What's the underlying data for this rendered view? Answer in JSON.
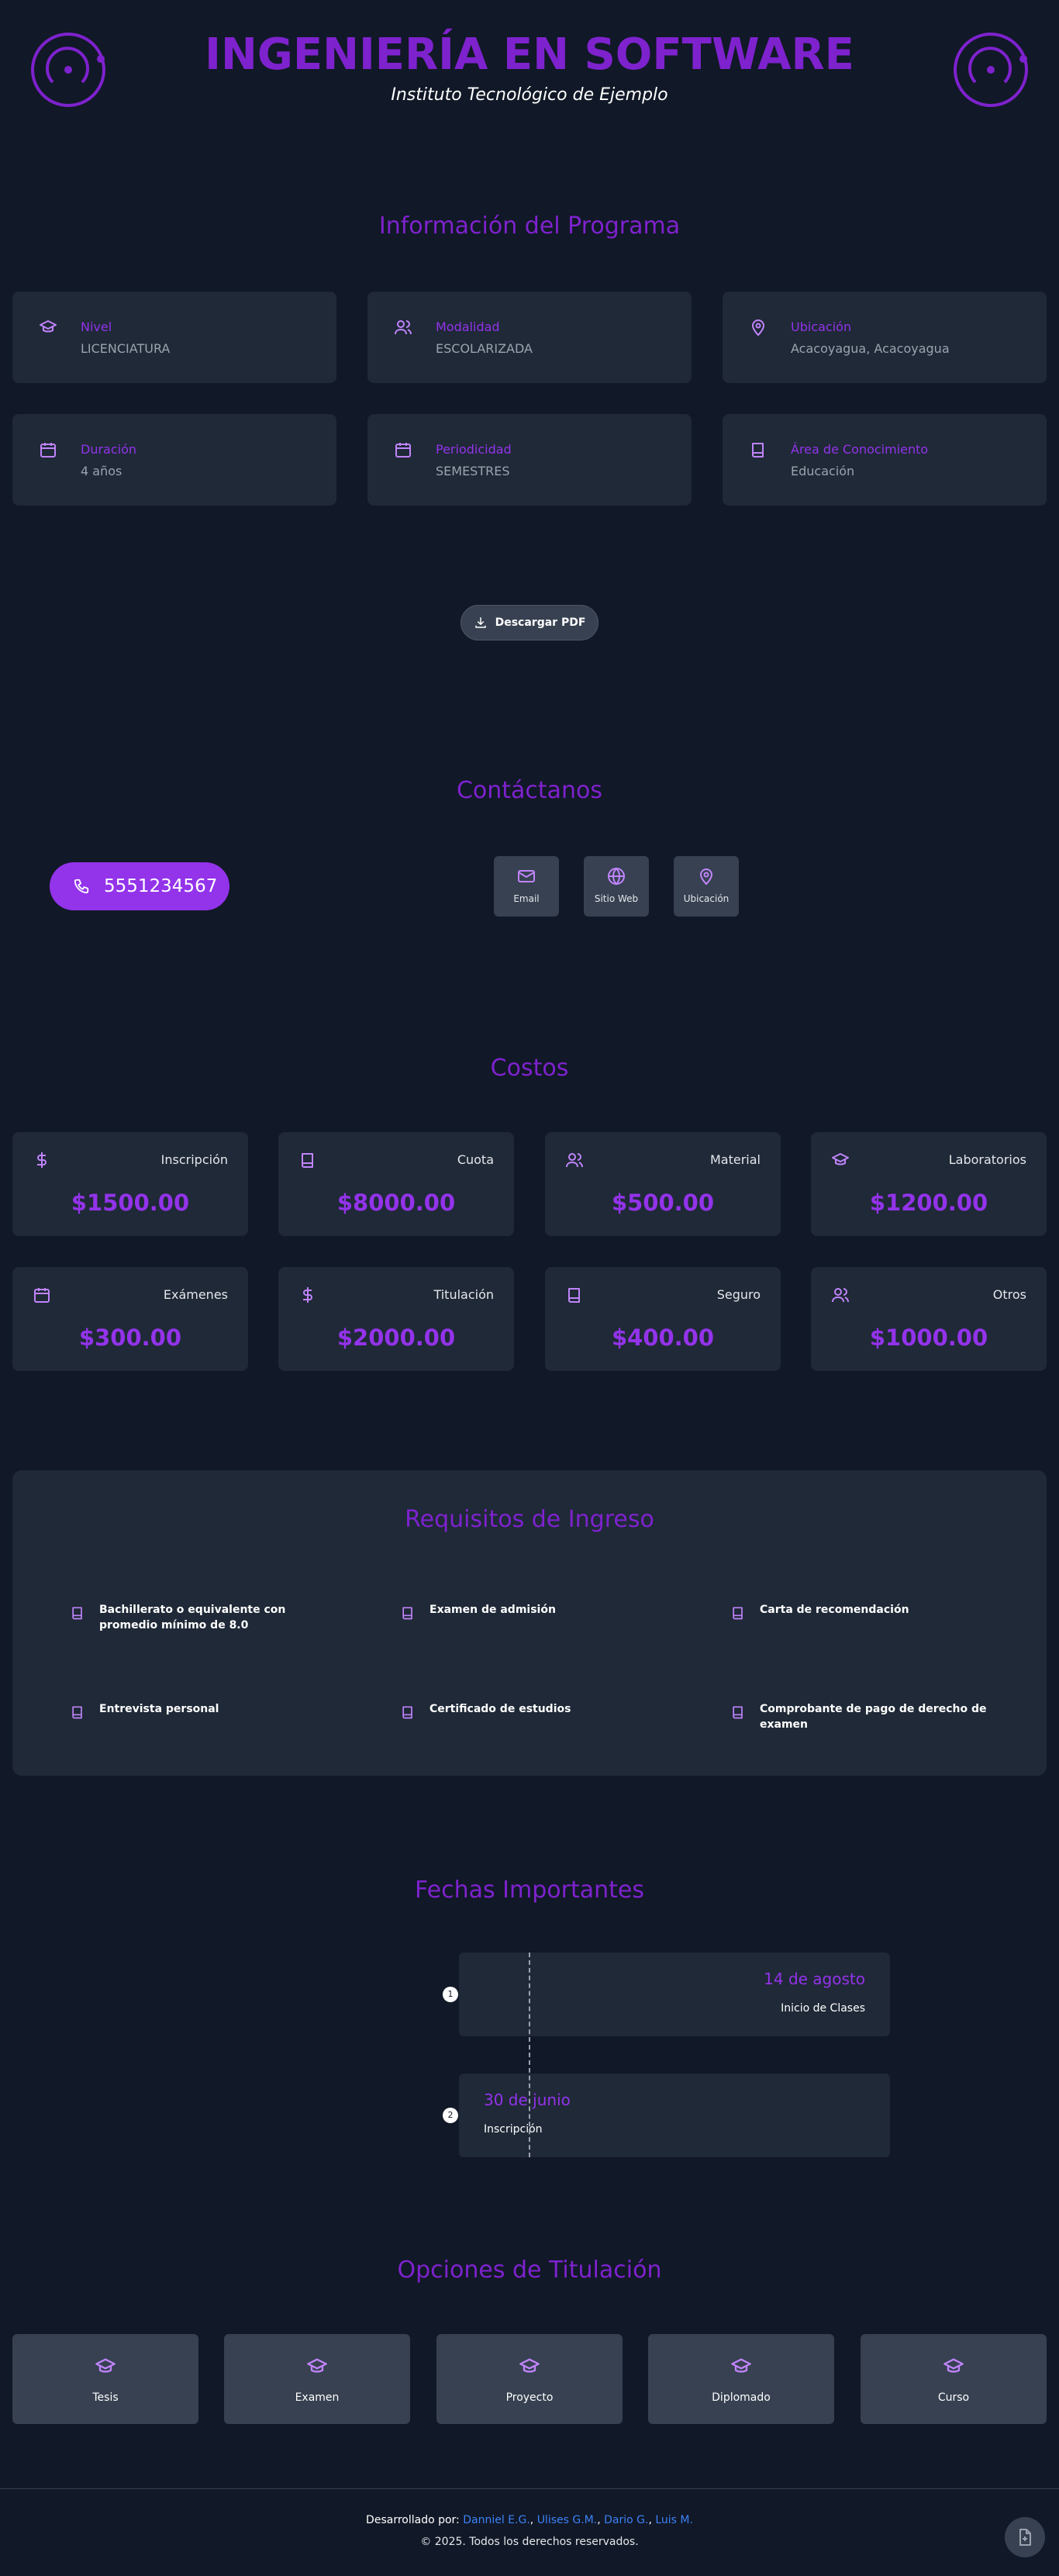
{
  "header": {
    "title": "INGENIERÍA EN SOFTWARE",
    "subtitle": "Instituto Tecnológico de Ejemplo"
  },
  "program": {
    "title": "Información del Programa",
    "items": [
      {
        "icon": "graduation-cap-icon",
        "label": "Nivel",
        "value": "LICENCIATURA"
      },
      {
        "icon": "users-icon",
        "label": "Modalidad",
        "value": "ESCOLARIZADA"
      },
      {
        "icon": "map-pin-icon",
        "label": "Ubicación",
        "value": "Acacoyagua, Acacoyagua"
      },
      {
        "icon": "calendar-icon",
        "label": "Duración",
        "value": "4 años"
      },
      {
        "icon": "calendar-icon",
        "label": "Periodicidad",
        "value": "SEMESTRES"
      },
      {
        "icon": "book-icon",
        "label": "Área de Conocimiento",
        "value": "Educación"
      }
    ],
    "download_label": "Descargar PDF"
  },
  "contact": {
    "title": "Contáctanos",
    "phone": "5551234567",
    "tiles": [
      "Email",
      "Sitio Web",
      "Ubicación"
    ]
  },
  "costs": {
    "title": "Costos",
    "items": [
      {
        "icon": "dollar-icon",
        "name": "Inscripción",
        "amount": "$1500.00"
      },
      {
        "icon": "book-icon",
        "name": "Cuota",
        "amount": "$8000.00"
      },
      {
        "icon": "users-icon",
        "name": "Material",
        "amount": "$500.00"
      },
      {
        "icon": "graduation-cap-icon",
        "name": "Laboratorios",
        "amount": "$1200.00"
      },
      {
        "icon": "calendar-icon",
        "name": "Exámenes",
        "amount": "$300.00"
      },
      {
        "icon": "dollar-icon",
        "name": "Titulación",
        "amount": "$2000.00"
      },
      {
        "icon": "book-icon",
        "name": "Seguro",
        "amount": "$400.00"
      },
      {
        "icon": "users-icon",
        "name": "Otros",
        "amount": "$1000.00"
      }
    ]
  },
  "requirements": {
    "title": "Requisitos de Ingreso",
    "items": [
      "Bachillerato o equivalente con promedio mínimo de 8.0",
      "Examen de admisión",
      "Carta de recomendación",
      "Entrevista personal",
      "Certificado de estudios",
      "Comprobante de pago de derecho de examen"
    ]
  },
  "dates": {
    "title": "Fechas Importantes",
    "items": [
      {
        "n": "1",
        "date": "14 de agosto",
        "event": "Inicio de Clases"
      },
      {
        "n": "2",
        "date": "30 de junio",
        "event": "Inscripción"
      }
    ]
  },
  "options": {
    "title": "Opciones de Titulación",
    "items": [
      "Tesis",
      "Examen",
      "Proyecto",
      "Diplomado",
      "Curso"
    ]
  },
  "footer": {
    "dev_prefix": "Desarrollado por:",
    "devs": [
      "Danniel E.G.",
      "Ulises G.M.",
      "Dario G.",
      "Luis M."
    ],
    "copyright": "© 2025. Todos los derechos reservados."
  },
  "colors": {
    "accent": "#7e22ce",
    "accent_light": "#9333ea",
    "icon": "#c084fc",
    "background": "#111827",
    "card": "#1f2937"
  }
}
